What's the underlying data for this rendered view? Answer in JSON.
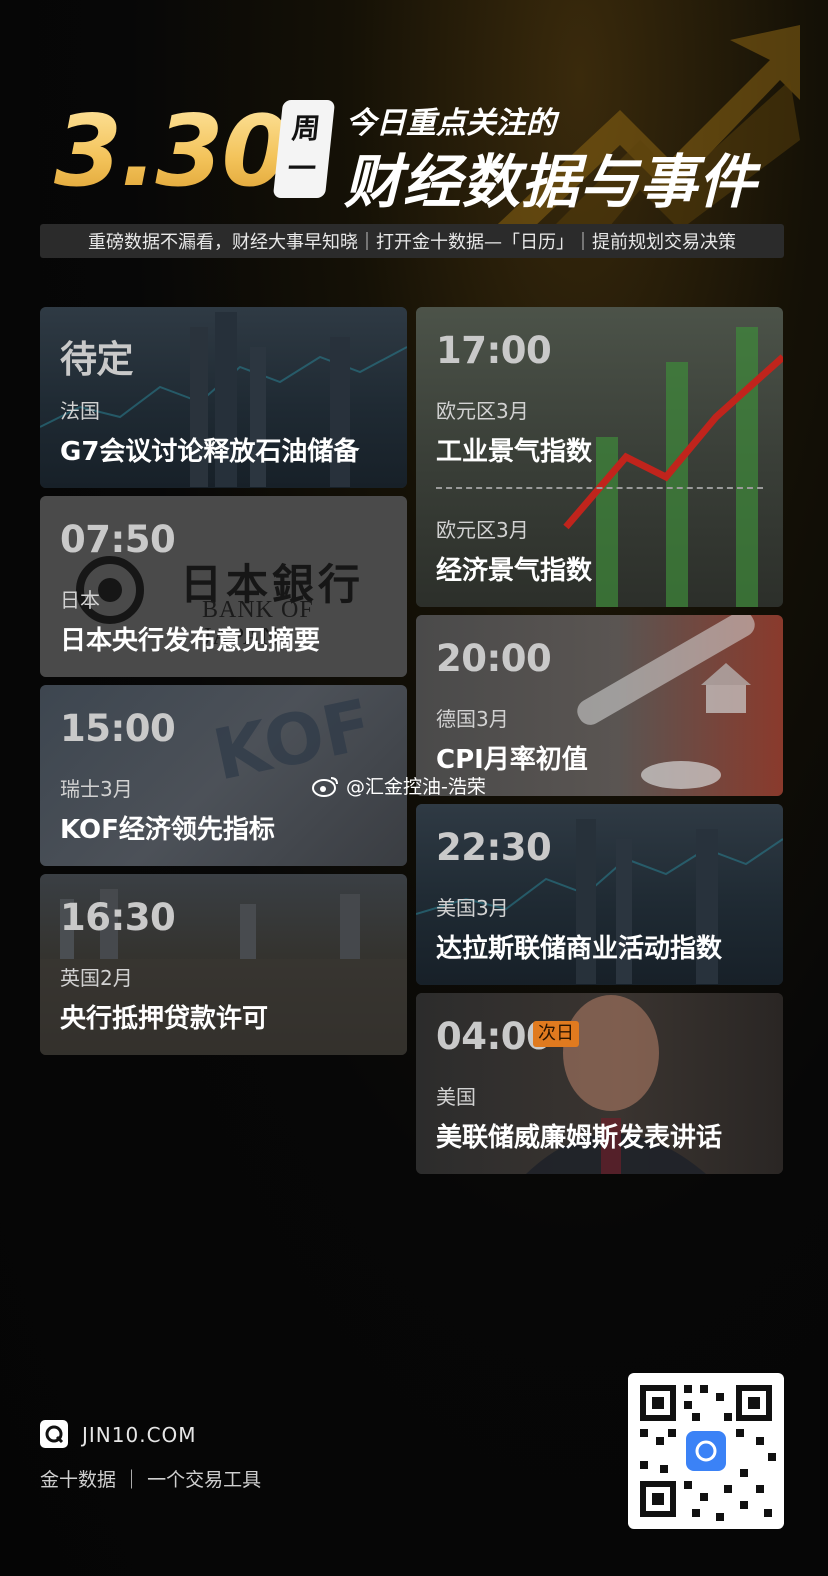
{
  "header": {
    "date": "3.30",
    "weekday_line1": "周",
    "weekday_line2": "一",
    "headline_small": "今日重点关注的",
    "headline_big": "财经数据与事件",
    "banner": "重磅数据不漏看，财经大事早知晓｜打开金十数据—「日历」｜提前规划交易决策"
  },
  "left_cards": [
    {
      "time": "待定",
      "region": "法国",
      "title": "G7会议讨论释放石油储备"
    },
    {
      "time": "07:50",
      "region": "日本",
      "title": "日本央行发布意见摘要",
      "logo_cn": "日本銀行",
      "logo_en": "BANK OF JAPAN"
    },
    {
      "time": "15:00",
      "region": "瑞士3月",
      "title": "KOF经济领先指标"
    },
    {
      "time": "16:30",
      "region": "英国2月",
      "title": "央行抵押贷款许可"
    }
  ],
  "right_cards": [
    {
      "time": "17:00",
      "region": "欧元区3月",
      "title": "工业景气指数",
      "region2": "欧元区3月",
      "title2": "经济景气指数"
    },
    {
      "time": "20:00",
      "region": "德国3月",
      "title": "CPI月率初值"
    },
    {
      "time": "22:30",
      "region": "美国3月",
      "title": "达拉斯联储商业活动指数"
    },
    {
      "time": "04:00",
      "badge": "次日",
      "region": "美国",
      "title": "美联储威廉姆斯发表讲话"
    }
  ],
  "watermark": "@汇金控油-浩荣",
  "footer": {
    "domain": "JIN10.COM",
    "tagline": "金十数据 ｜ 一个交易工具"
  },
  "colors": {
    "accent_gold": "#f3c35a",
    "badge_orange": "#e07a1f",
    "card_bg": "#262626"
  },
  "icons": [
    "jin10-logo-icon",
    "weibo-icon",
    "qr-code-icon",
    "trend-arrow-icon"
  ]
}
